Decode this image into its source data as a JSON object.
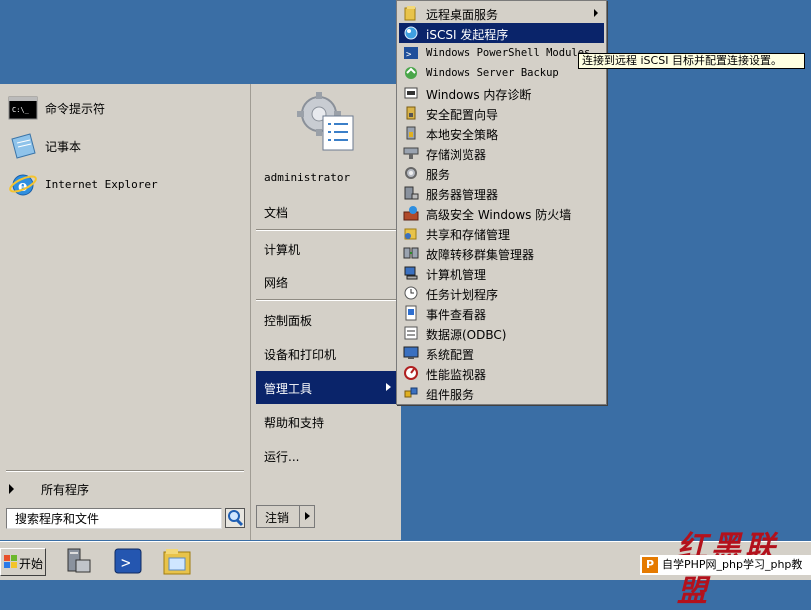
{
  "colors": {
    "desktop": "#3a6ea5",
    "menu_bg": "#d4d0c8",
    "highlight": "#0a246a",
    "tooltip_bg": "#ffffe1",
    "watermark": "#b3111c"
  },
  "start_menu": {
    "pinned": [
      {
        "label": "命令提示符",
        "icon": "command-prompt-icon"
      },
      {
        "label": "记事本",
        "icon": "notepad-icon"
      },
      {
        "label": "Internet Explorer",
        "icon": "internet-explorer-icon"
      }
    ],
    "all_programs": "所有程序",
    "search_placeholder": "搜索程序和文件",
    "user_name": "administrator",
    "right_items": [
      {
        "label": "文档"
      },
      {
        "label": "计算机"
      },
      {
        "label": "网络"
      },
      {
        "label": "控制面板"
      },
      {
        "label": "设备和打印机"
      },
      {
        "label": "管理工具",
        "active": true
      },
      {
        "label": "帮助和支持"
      },
      {
        "label": "运行..."
      }
    ],
    "logoff_label": "注销"
  },
  "admin_tools": {
    "items": [
      {
        "label": "远程桌面服务",
        "icon": "folder-icon",
        "submenu": true
      },
      {
        "label": "iSCSI 发起程序",
        "icon": "iscsi-icon",
        "active": true
      },
      {
        "label": "Windows PowerShell Modules",
        "icon": "powershell-icon"
      },
      {
        "label": "Windows Server Backup",
        "icon": "backup-icon"
      },
      {
        "label": "Windows 内存诊断",
        "icon": "memory-icon"
      },
      {
        "label": "安全配置向导",
        "icon": "security-wizard-icon"
      },
      {
        "label": "本地安全策略",
        "icon": "local-policy-icon"
      },
      {
        "label": "存储浏览器",
        "icon": "storage-icon"
      },
      {
        "label": "服务",
        "icon": "services-icon"
      },
      {
        "label": "服务器管理器",
        "icon": "server-manager-icon"
      },
      {
        "label": "高级安全 Windows 防火墙",
        "icon": "firewall-icon"
      },
      {
        "label": "共享和存储管理",
        "icon": "share-icon"
      },
      {
        "label": "故障转移群集管理器",
        "icon": "cluster-icon"
      },
      {
        "label": "计算机管理",
        "icon": "computer-management-icon"
      },
      {
        "label": "任务计划程序",
        "icon": "clock-icon"
      },
      {
        "label": "事件查看器",
        "icon": "event-viewer-icon"
      },
      {
        "label": "数据源(ODBC)",
        "icon": "odbc-icon"
      },
      {
        "label": "系统配置",
        "icon": "system-config-icon"
      },
      {
        "label": "性能监视器",
        "icon": "performance-icon"
      },
      {
        "label": "组件服务",
        "icon": "component-services-icon"
      }
    ],
    "tooltip": "连接到远程 iSCSI 目标并配置连接设置。"
  },
  "taskbar": {
    "start_label": "开始",
    "pinned_icons": [
      "server-manager-icon",
      "powershell-icon",
      "explorer-icon"
    ]
  },
  "watermark": "红黑联盟",
  "site_text": "自学PHP网_php学习_php教"
}
